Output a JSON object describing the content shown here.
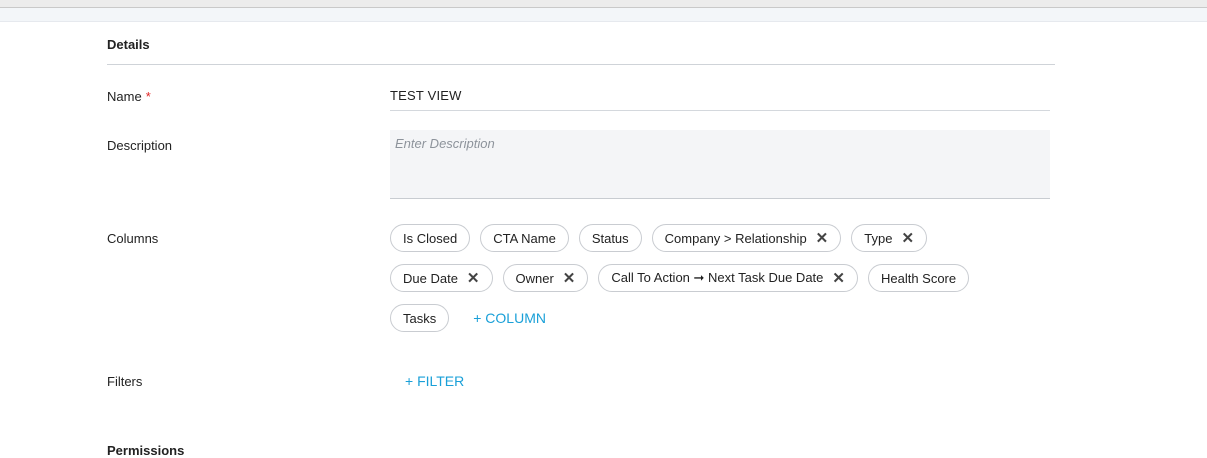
{
  "details": {
    "title": "Details",
    "name_label": "Name",
    "required_mark": "*",
    "name_value": "TEST VIEW",
    "description_label": "Description",
    "description_placeholder": "Enter Description",
    "columns_label": "Columns",
    "columns": [
      {
        "label": "Is Closed",
        "removable": false
      },
      {
        "label": "CTA Name",
        "removable": false
      },
      {
        "label": "Status",
        "removable": false
      },
      {
        "label": "Company > Relationship",
        "removable": true
      },
      {
        "label": "Type",
        "removable": true
      },
      {
        "label": "Due Date",
        "removable": true
      },
      {
        "label": "Owner",
        "removable": true
      },
      {
        "label": "Call To Action ➞ Next Task Due Date",
        "removable": true
      },
      {
        "label": "Health Score",
        "removable": false
      },
      {
        "label": "Tasks",
        "removable": false
      }
    ],
    "remove_glyph": "✕",
    "add_column_label": "+ COLUMN",
    "filters_label": "Filters",
    "add_filter_label": "+ FILTER",
    "next_section_label": "Permissions"
  },
  "colors": {
    "accent": "#1aa0d8",
    "required": "#e02424"
  }
}
